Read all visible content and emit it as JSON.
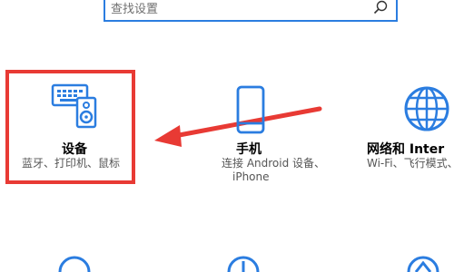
{
  "search": {
    "placeholder": "查找设置"
  },
  "tiles": [
    {
      "title": "设备",
      "desc_lines": [
        "蓝牙、打印机、鼠标"
      ],
      "icon": "devices-icon"
    },
    {
      "title": "手机",
      "desc_lines": [
        "连接 Android 设备、",
        "iPhone"
      ],
      "icon": "phone-icon"
    },
    {
      "title": "网络和 Inter",
      "desc_lines": [
        "Wi-Fi、飞行模式、"
      ],
      "icon": "globe-icon"
    }
  ],
  "colors": {
    "accent": "#2b7de0",
    "highlight": "#e83a34"
  }
}
